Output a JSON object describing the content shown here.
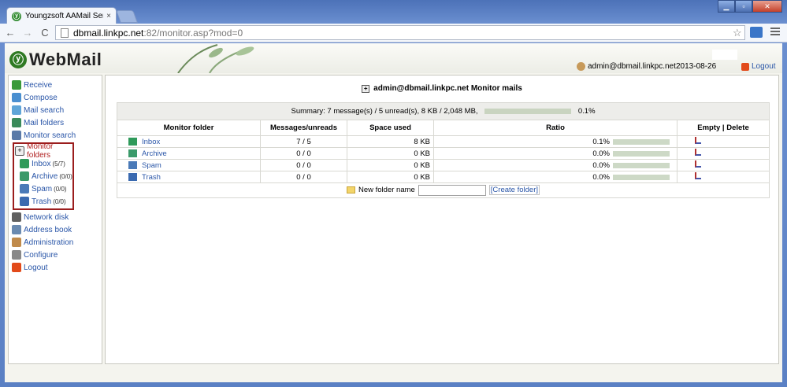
{
  "browser": {
    "tab_title": "Youngzsoft AAMail Server",
    "tab_close": "×",
    "url_host": "dbmail.linkpc.net",
    "url_path": ":82/monitor.asp?mod=0"
  },
  "header": {
    "logo_text": "WebMail",
    "user": "admin@dbmail.linkpc.net",
    "date": "2013-08-26",
    "logout": "Logout"
  },
  "sidebar": {
    "items": [
      {
        "label": "Receive",
        "icon": "receive-icon",
        "color": "#3a9a3a"
      },
      {
        "label": "Compose",
        "icon": "compose-icon",
        "color": "#4a8fd0"
      },
      {
        "label": "Mail search",
        "icon": "mail-search-icon",
        "color": "#5fa5d8"
      },
      {
        "label": "Mail folders",
        "icon": "mail-folders-icon",
        "color": "#3a8a5a"
      },
      {
        "label": "Monitor search",
        "icon": "monitor-search-icon",
        "color": "#5a7aa8"
      }
    ],
    "monitor_folders": {
      "label": "Monitor folders",
      "subs": [
        {
          "label": "Inbox",
          "count": "(5/7)"
        },
        {
          "label": "Archive",
          "count": "(0/0)"
        },
        {
          "label": "Spam",
          "count": "(0/0)"
        },
        {
          "label": "Trash",
          "count": "(0/0)"
        }
      ]
    },
    "items2": [
      {
        "label": "Network disk",
        "icon": "network-disk-icon",
        "color": "#606060"
      },
      {
        "label": "Address book",
        "icon": "address-book-icon",
        "color": "#6a8ab0"
      },
      {
        "label": "Administration",
        "icon": "administration-icon",
        "color": "#c08a4a"
      },
      {
        "label": "Configure",
        "icon": "configure-icon",
        "color": "#888888"
      },
      {
        "label": "Logout",
        "icon": "logout-icon",
        "color": "#e24a1a"
      }
    ]
  },
  "main": {
    "title": "admin@dbmail.linkpc.net Monitor mails",
    "summary_label": "Summary",
    "summary_text": "7 message(s) / 5 unread(s),  8 KB / 2,048 MB,",
    "summary_pct": "0.1%",
    "columns": [
      "Monitor folder",
      "Messages/unreads",
      "Space used",
      "Ratio",
      "Empty | Delete"
    ],
    "rows": [
      {
        "folder": "Inbox",
        "msgs": "7 / 5",
        "space": "8 KB",
        "ratio": "0.1%",
        "fill": 0.1
      },
      {
        "folder": "Archive",
        "msgs": "0 / 0",
        "space": "0 KB",
        "ratio": "0.0%",
        "fill": 0
      },
      {
        "folder": "Spam",
        "msgs": "0 / 0",
        "space": "0 KB",
        "ratio": "0.0%",
        "fill": 0
      },
      {
        "folder": "Trash",
        "msgs": "0 / 0",
        "space": "0 KB",
        "ratio": "0.0%",
        "fill": 0
      }
    ],
    "new_folder_label": "New folder name",
    "new_folder_value": "",
    "create_folder": "[Create folder]"
  }
}
